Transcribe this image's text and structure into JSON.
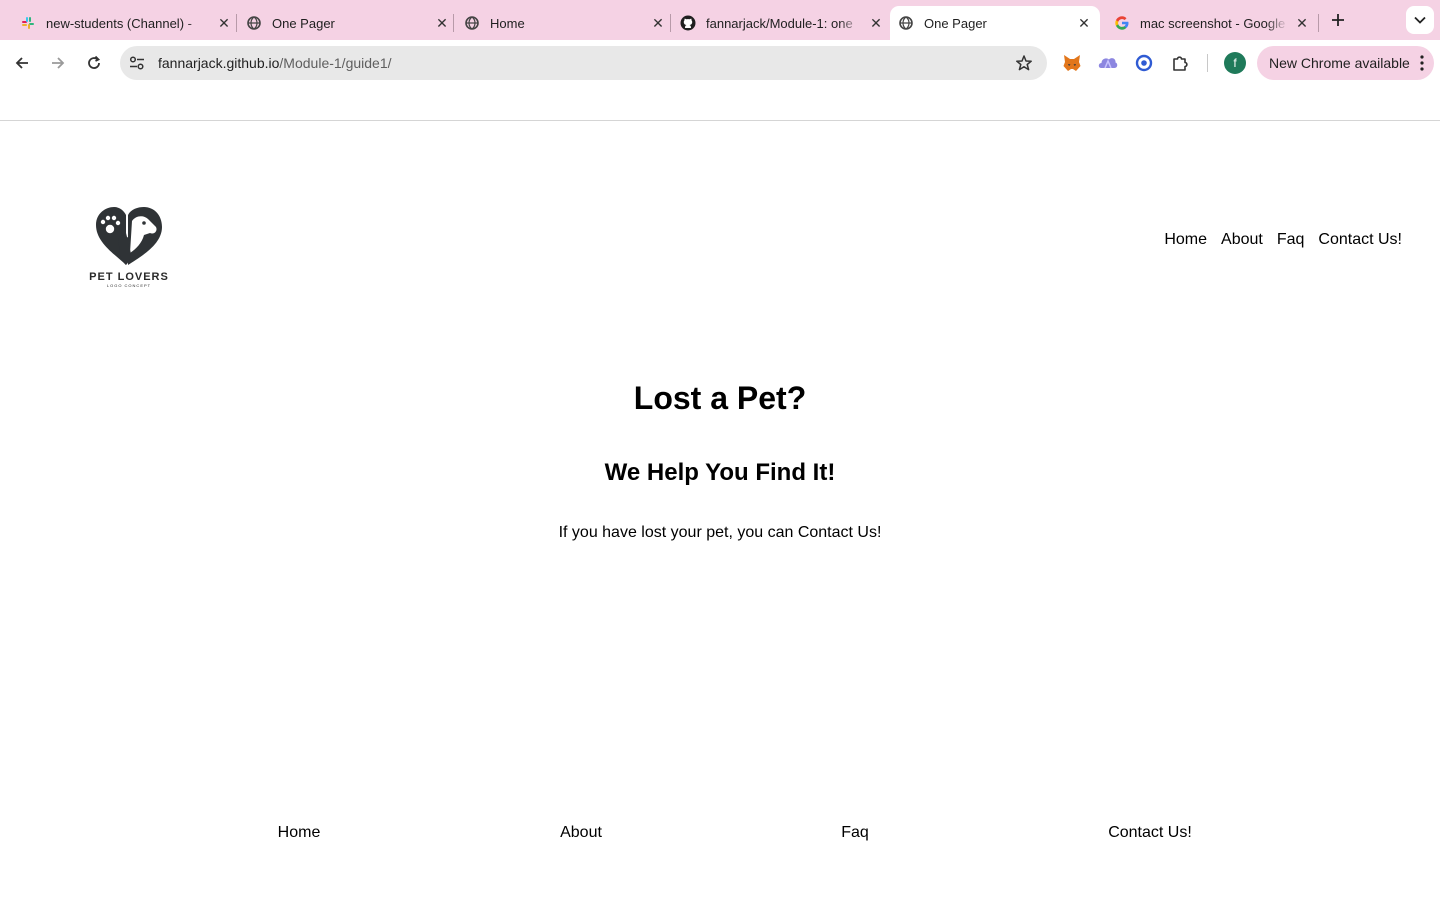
{
  "browser": {
    "tabs": [
      {
        "title": "new-students (Channel) - ",
        "favicon": "slack-icon",
        "active": false
      },
      {
        "title": "One Pager",
        "favicon": "globe-icon",
        "active": false
      },
      {
        "title": "Home",
        "favicon": "globe-icon",
        "active": false
      },
      {
        "title": "fannarjack/Module-1: one",
        "favicon": "github-icon",
        "active": false
      },
      {
        "title": "One Pager",
        "favicon": "globe-icon",
        "active": true
      },
      {
        "title": "mac screenshot - Google",
        "favicon": "google-icon",
        "active": false
      }
    ],
    "url_domain": "fannarjack.github.io",
    "url_path": "/Module-1/guide1/",
    "profile_initial": "f",
    "update_label": "New Chrome available",
    "colors": {
      "tabstrip": "#f5d2e4",
      "profile": "#1f7a5a"
    }
  },
  "site": {
    "logo_text": "PET LOVERS",
    "logo_subtext": "LOGO CONCEPT",
    "nav": [
      "Home",
      "About",
      "Faq",
      "Contact Us!"
    ],
    "hero": {
      "title": "Lost a Pet?",
      "subtitle": "We Help You Find It!",
      "text": "If you have lost your pet, you can Contact Us!"
    },
    "footer_nav": [
      "Home",
      "About",
      "Faq",
      "Contact Us!"
    ]
  }
}
